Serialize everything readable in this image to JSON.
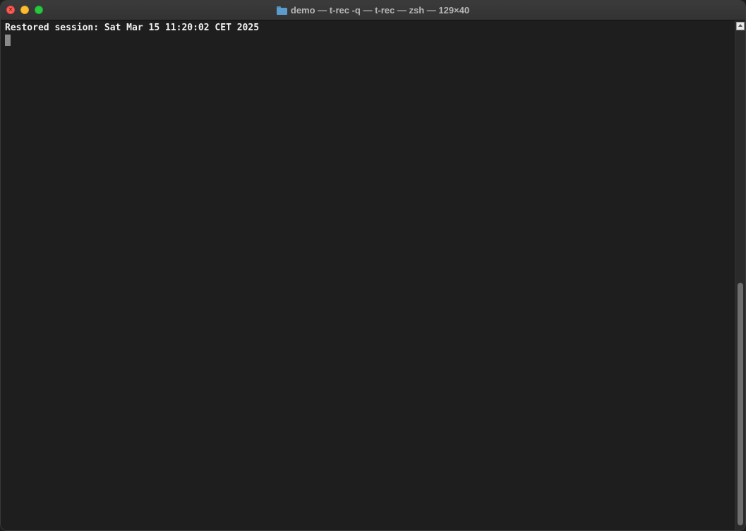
{
  "window": {
    "title": "demo — t-rec -q — t-rec — zsh — 129×40",
    "icon": "folder-icon",
    "traffic_lights": {
      "close_glyph": "×",
      "close_color": "#ff5f57",
      "minimize_color": "#febc2e",
      "maximize_color": "#28c840"
    }
  },
  "terminal": {
    "lines": [
      "Restored session: Sat Mar 15 11:20:02 CET 2025"
    ],
    "background_color": "#1e1e1e",
    "text_color": "#f2f2f2"
  },
  "scrollbar": {
    "thumb_position_fraction": 0.52,
    "thumb_size_fraction": 0.48
  }
}
